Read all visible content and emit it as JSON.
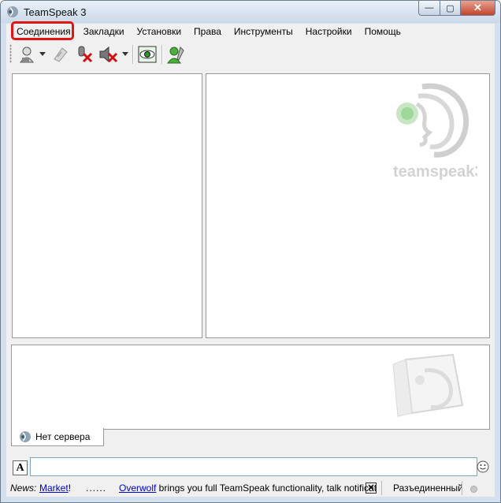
{
  "window": {
    "title": "TeamSpeak 3",
    "app_icon": "teamspeak-icon"
  },
  "menu": [
    "Соединения",
    "Закладки",
    "Установки",
    "Права",
    "Инструменты",
    "Настройки",
    "Помощь"
  ],
  "toolbar": {
    "icons": [
      "connect-icon",
      "disconnect-icon",
      "mute-microphone-icon",
      "mute-speakers-icon",
      "away-status-icon",
      "avatar-settings-icon"
    ]
  },
  "watermark": {
    "text": "teamspeak3"
  },
  "tabs": [
    {
      "label": "Нет сервера",
      "icon": "teamspeak-icon"
    }
  ],
  "chat_input": {
    "value": "",
    "placeholder": ""
  },
  "statusbar": {
    "news_label": "News:",
    "market_link": "Market",
    "market_suffix": "!",
    "dots": "......",
    "overwolf_link": "Overwolf",
    "news_text": " brings you full TeamSpeak functionality, talk notificat",
    "connection_status": "Разъединенный"
  },
  "colors": {
    "highlight": "#e01515",
    "link": "#0000cc",
    "window_frame": "#d4e0ee"
  }
}
